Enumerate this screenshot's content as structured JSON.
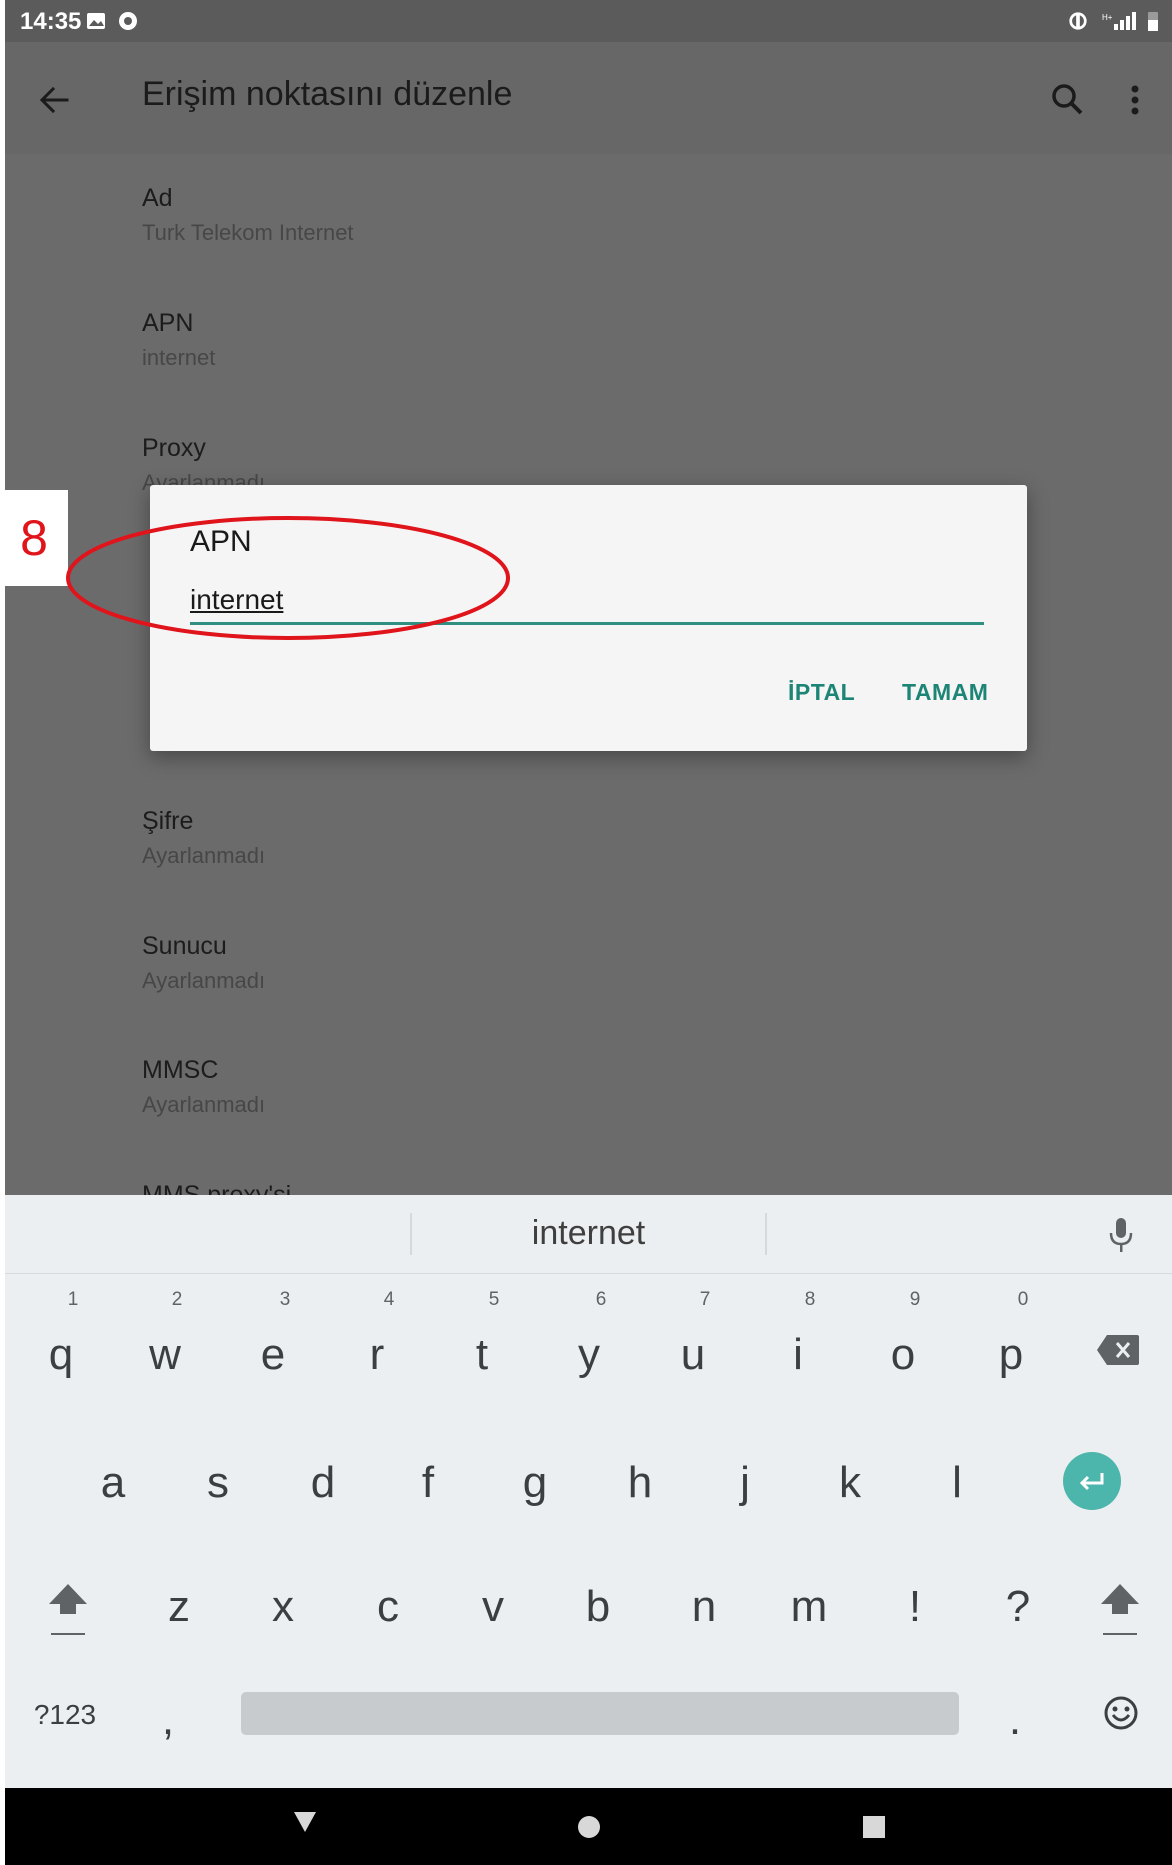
{
  "status_bar": {
    "time": "14:35"
  },
  "app_bar": {
    "title": "Erişim noktasını düzenle"
  },
  "preferences": [
    {
      "title": "Ad",
      "summary": "Turk Telekom Internet"
    },
    {
      "title": "APN",
      "summary": "internet"
    },
    {
      "title": "Proxy",
      "summary": "Ayarlanmadı"
    },
    {
      "title": "Şifre",
      "summary": "Ayarlanmadı"
    },
    {
      "title": "Sunucu",
      "summary": "Ayarlanmadı"
    },
    {
      "title": "MMSC",
      "summary": "Ayarlanmadı"
    },
    {
      "title": "MMS proxy'si",
      "summary": ""
    }
  ],
  "dialog": {
    "title": "APN",
    "input_value": "internet",
    "cancel_label": "İPTAL",
    "ok_label": "TAMAM"
  },
  "annotation": {
    "step_number": "8",
    "color": "#e0141b"
  },
  "keyboard": {
    "suggestion": "internet",
    "row1": [
      "q",
      "w",
      "e",
      "r",
      "t",
      "y",
      "u",
      "i",
      "o",
      "p"
    ],
    "row1_hints": [
      "1",
      "2",
      "3",
      "4",
      "5",
      "6",
      "7",
      "8",
      "9",
      "0"
    ],
    "row2": [
      "a",
      "s",
      "d",
      "f",
      "g",
      "h",
      "j",
      "k",
      "l"
    ],
    "row3": [
      "z",
      "x",
      "c",
      "v",
      "b",
      "n",
      "m",
      "!",
      "?"
    ],
    "row4": {
      "symbols_key": "?123",
      "comma": ",",
      "period": "."
    },
    "icons": [
      "mic-icon",
      "backspace-icon",
      "enter-icon",
      "shift-icon",
      "emoji-icon"
    ],
    "enter_key_color": "#4db6ac"
  },
  "accent_color": "#1d8576"
}
